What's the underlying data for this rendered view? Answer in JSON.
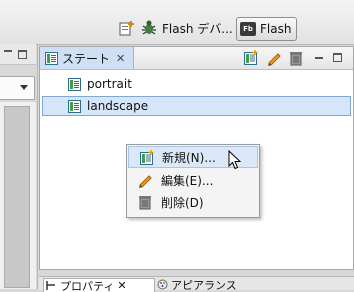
{
  "perspectives": {
    "open_icon": "open-perspective-icon",
    "flash_debug_label": "Flash デバ...",
    "flash_label": "Flash",
    "flash_logo_text": "Fb"
  },
  "states_view": {
    "tab_label": "ステート",
    "tab_close": "✕",
    "toolbar_icons": [
      "new-state-icon",
      "edit-state-icon",
      "delete-state-icon",
      "minimize-icon",
      "maximize-icon"
    ],
    "states": [
      {
        "label": "portrait",
        "selected": false
      },
      {
        "label": "landscape",
        "selected": true
      }
    ]
  },
  "context_menu": {
    "items": [
      {
        "label": "新規(N)...",
        "icon": "new-state-icon",
        "highlighted": true
      },
      {
        "label": "編集(E)...",
        "icon": "pencil-icon",
        "highlighted": false
      },
      {
        "label": "削除(D)",
        "icon": "trash-icon",
        "highlighted": false
      }
    ]
  },
  "bottom_tabs": {
    "properties_label": "プロパティ",
    "properties_close": "✕",
    "appearance_label": "アピアランス"
  },
  "colors": {
    "selection_bg": "#d6e6fa",
    "selection_border": "#7fa6d6",
    "tab_active_bg": "#cfe0f5"
  }
}
